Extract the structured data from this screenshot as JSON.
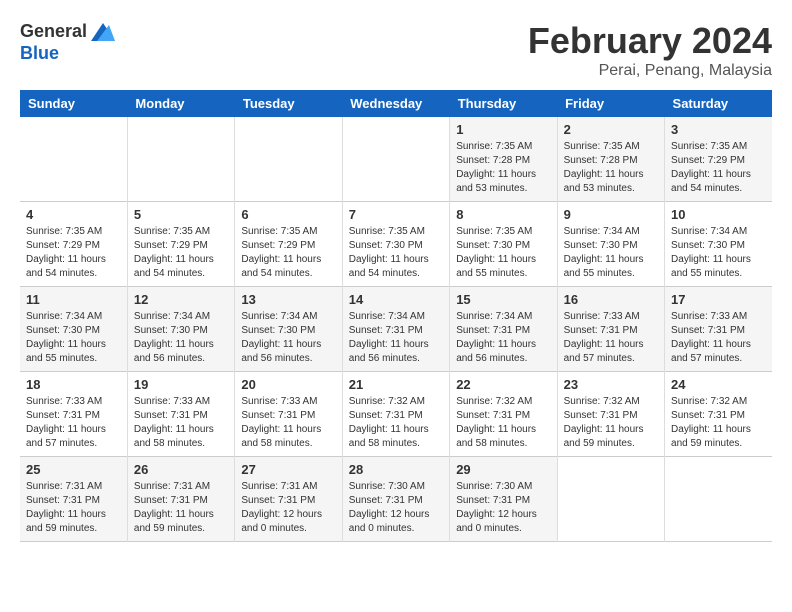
{
  "logo": {
    "general": "General",
    "blue": "Blue"
  },
  "title": {
    "month_year": "February 2024",
    "location": "Perai, Penang, Malaysia"
  },
  "headers": [
    "Sunday",
    "Monday",
    "Tuesday",
    "Wednesday",
    "Thursday",
    "Friday",
    "Saturday"
  ],
  "weeks": [
    [
      {
        "day": "",
        "info": ""
      },
      {
        "day": "",
        "info": ""
      },
      {
        "day": "",
        "info": ""
      },
      {
        "day": "",
        "info": ""
      },
      {
        "day": "1",
        "info": "Sunrise: 7:35 AM\nSunset: 7:28 PM\nDaylight: 11 hours\nand 53 minutes."
      },
      {
        "day": "2",
        "info": "Sunrise: 7:35 AM\nSunset: 7:28 PM\nDaylight: 11 hours\nand 53 minutes."
      },
      {
        "day": "3",
        "info": "Sunrise: 7:35 AM\nSunset: 7:29 PM\nDaylight: 11 hours\nand 54 minutes."
      }
    ],
    [
      {
        "day": "4",
        "info": "Sunrise: 7:35 AM\nSunset: 7:29 PM\nDaylight: 11 hours\nand 54 minutes."
      },
      {
        "day": "5",
        "info": "Sunrise: 7:35 AM\nSunset: 7:29 PM\nDaylight: 11 hours\nand 54 minutes."
      },
      {
        "day": "6",
        "info": "Sunrise: 7:35 AM\nSunset: 7:29 PM\nDaylight: 11 hours\nand 54 minutes."
      },
      {
        "day": "7",
        "info": "Sunrise: 7:35 AM\nSunset: 7:30 PM\nDaylight: 11 hours\nand 54 minutes."
      },
      {
        "day": "8",
        "info": "Sunrise: 7:35 AM\nSunset: 7:30 PM\nDaylight: 11 hours\nand 55 minutes."
      },
      {
        "day": "9",
        "info": "Sunrise: 7:34 AM\nSunset: 7:30 PM\nDaylight: 11 hours\nand 55 minutes."
      },
      {
        "day": "10",
        "info": "Sunrise: 7:34 AM\nSunset: 7:30 PM\nDaylight: 11 hours\nand 55 minutes."
      }
    ],
    [
      {
        "day": "11",
        "info": "Sunrise: 7:34 AM\nSunset: 7:30 PM\nDaylight: 11 hours\nand 55 minutes."
      },
      {
        "day": "12",
        "info": "Sunrise: 7:34 AM\nSunset: 7:30 PM\nDaylight: 11 hours\nand 56 minutes."
      },
      {
        "day": "13",
        "info": "Sunrise: 7:34 AM\nSunset: 7:30 PM\nDaylight: 11 hours\nand 56 minutes."
      },
      {
        "day": "14",
        "info": "Sunrise: 7:34 AM\nSunset: 7:31 PM\nDaylight: 11 hours\nand 56 minutes."
      },
      {
        "day": "15",
        "info": "Sunrise: 7:34 AM\nSunset: 7:31 PM\nDaylight: 11 hours\nand 56 minutes."
      },
      {
        "day": "16",
        "info": "Sunrise: 7:33 AM\nSunset: 7:31 PM\nDaylight: 11 hours\nand 57 minutes."
      },
      {
        "day": "17",
        "info": "Sunrise: 7:33 AM\nSunset: 7:31 PM\nDaylight: 11 hours\nand 57 minutes."
      }
    ],
    [
      {
        "day": "18",
        "info": "Sunrise: 7:33 AM\nSunset: 7:31 PM\nDaylight: 11 hours\nand 57 minutes."
      },
      {
        "day": "19",
        "info": "Sunrise: 7:33 AM\nSunset: 7:31 PM\nDaylight: 11 hours\nand 58 minutes."
      },
      {
        "day": "20",
        "info": "Sunrise: 7:33 AM\nSunset: 7:31 PM\nDaylight: 11 hours\nand 58 minutes."
      },
      {
        "day": "21",
        "info": "Sunrise: 7:32 AM\nSunset: 7:31 PM\nDaylight: 11 hours\nand 58 minutes."
      },
      {
        "day": "22",
        "info": "Sunrise: 7:32 AM\nSunset: 7:31 PM\nDaylight: 11 hours\nand 58 minutes."
      },
      {
        "day": "23",
        "info": "Sunrise: 7:32 AM\nSunset: 7:31 PM\nDaylight: 11 hours\nand 59 minutes."
      },
      {
        "day": "24",
        "info": "Sunrise: 7:32 AM\nSunset: 7:31 PM\nDaylight: 11 hours\nand 59 minutes."
      }
    ],
    [
      {
        "day": "25",
        "info": "Sunrise: 7:31 AM\nSunset: 7:31 PM\nDaylight: 11 hours\nand 59 minutes."
      },
      {
        "day": "26",
        "info": "Sunrise: 7:31 AM\nSunset: 7:31 PM\nDaylight: 11 hours\nand 59 minutes."
      },
      {
        "day": "27",
        "info": "Sunrise: 7:31 AM\nSunset: 7:31 PM\nDaylight: 12 hours\nand 0 minutes."
      },
      {
        "day": "28",
        "info": "Sunrise: 7:30 AM\nSunset: 7:31 PM\nDaylight: 12 hours\nand 0 minutes."
      },
      {
        "day": "29",
        "info": "Sunrise: 7:30 AM\nSunset: 7:31 PM\nDaylight: 12 hours\nand 0 minutes."
      },
      {
        "day": "",
        "info": ""
      },
      {
        "day": "",
        "info": ""
      }
    ]
  ]
}
